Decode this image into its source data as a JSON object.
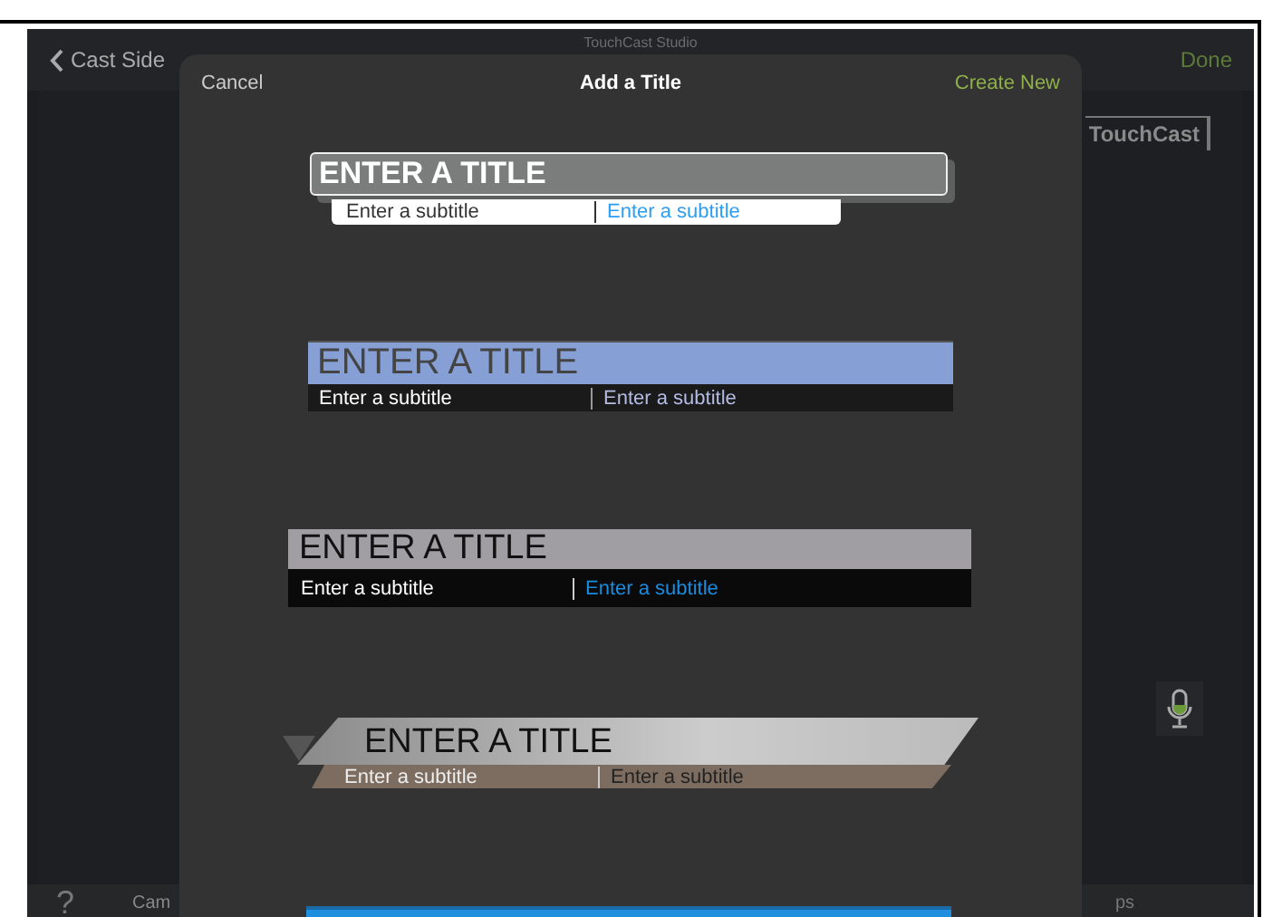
{
  "app_bar": {
    "back_label": "Cast Side",
    "app_title": "TouchCast Studio",
    "done_label": "Done"
  },
  "logo": {
    "text": "TouchCast"
  },
  "bottom_bar": {
    "help": "?",
    "left_label": "Cam",
    "right_label": "ps"
  },
  "dialog": {
    "cancel": "Cancel",
    "title": "Add a Title",
    "create": "Create New",
    "templates": [
      {
        "kind": "outlined",
        "title": "ENTER A TITLE",
        "subtitles": [
          "Enter a subtitle",
          "Enter a subtitle"
        ]
      },
      {
        "kind": "blue-band",
        "title": "ENTER A TITLE",
        "subtitles": [
          "Enter a subtitle",
          "Enter a subtitle"
        ]
      },
      {
        "kind": "grey-band",
        "title": "ENTER A TITLE",
        "subtitles": [
          "Enter a subtitle",
          "Enter a subtitle"
        ]
      },
      {
        "kind": "slanted",
        "title": "ENTER A TITLE",
        "subtitles": [
          "Enter a subtitle",
          "Enter a subtitle"
        ]
      },
      {
        "kind": "blue"
      }
    ]
  }
}
